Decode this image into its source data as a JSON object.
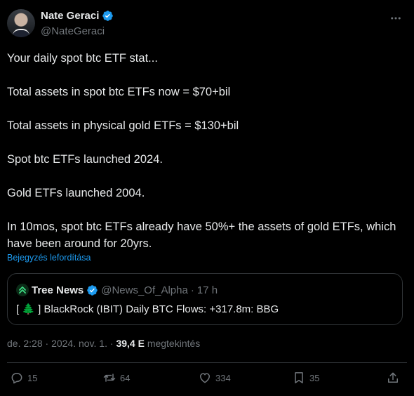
{
  "author": {
    "name": "Nate Geraci",
    "handle": "@NateGeraci"
  },
  "tweet": {
    "paragraphs": [
      "Your daily spot btc ETF stat...",
      "Total assets in spot btc ETFs now = $70+bil",
      "Total assets in physical gold ETFs = $130+bil",
      "Spot btc ETFs launched 2024.",
      "Gold ETFs launched 2004.",
      "In 10mos, spot btc ETFs already have 50%+ the assets of gold ETFs, which have been around for 20yrs."
    ],
    "translate_label": "Bejegyzés lefordítása"
  },
  "quote": {
    "name": "Tree News",
    "handle": "@News_Of_Alpha",
    "time": "17 h",
    "separator": "·",
    "text": "[ 🌲 ] BlackRock (IBIT) Daily BTC Flows: +317.8m: BBG"
  },
  "meta": {
    "time": "de. 2:28",
    "date": "2024. nov. 1.",
    "separator": "·",
    "views_count": "39,4 E",
    "views_label": "megtekintés"
  },
  "actions": {
    "replies": "15",
    "retweets": "64",
    "likes": "334",
    "bookmarks": "35"
  },
  "colors": {
    "background": "#000000",
    "accent": "#1d9bf0",
    "muted": "#71767b",
    "text": "#e7e9ea"
  }
}
